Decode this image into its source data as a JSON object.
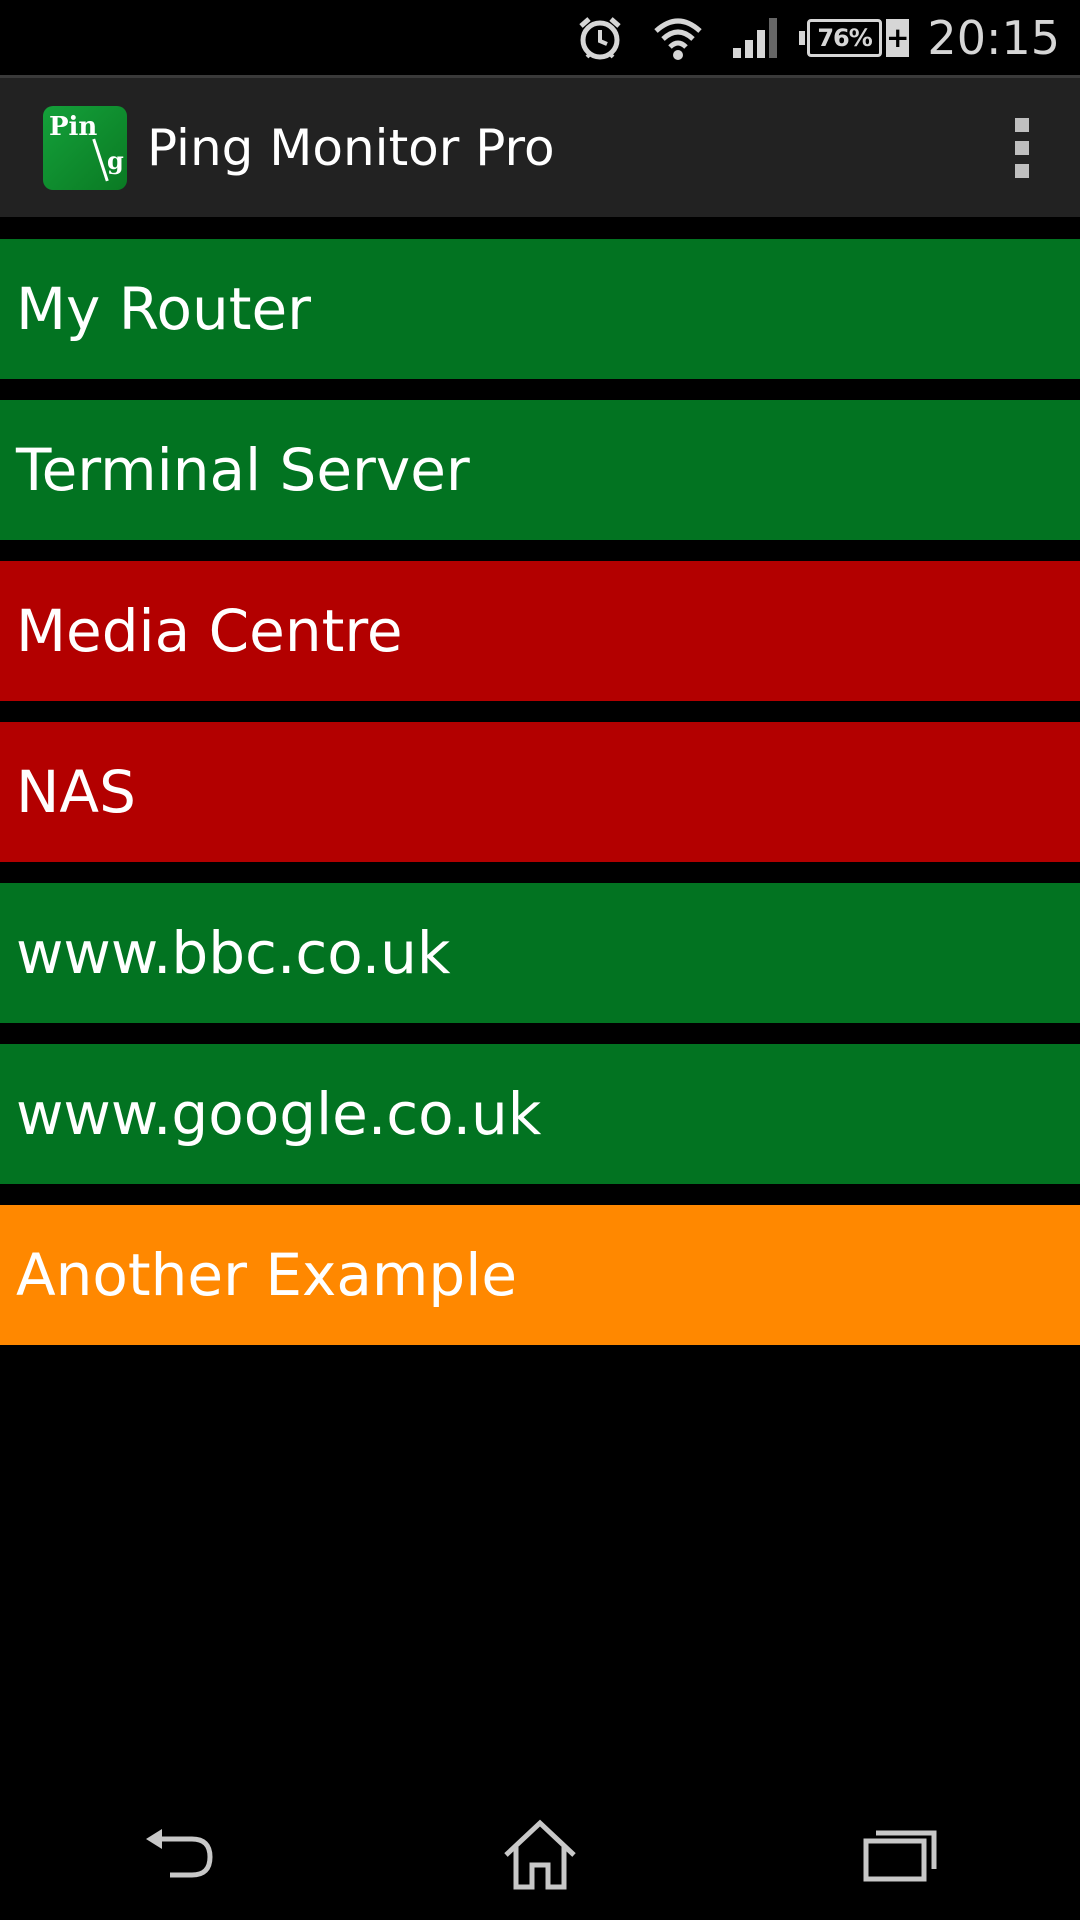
{
  "status_bar": {
    "battery_percent": "76%",
    "battery_plus": "+",
    "time": "20:15",
    "icons": [
      "alarm-icon",
      "wifi-icon",
      "cell-signal-icon",
      "battery-icon"
    ]
  },
  "action_bar": {
    "app_icon_text_top": "Pin",
    "app_icon_text_bottom": "g",
    "title": "Ping Monitor Pro",
    "overflow_icon": "overflow-menu-icon"
  },
  "colors": {
    "up": "#027321",
    "down": "#b30000",
    "warning": "#ff8800",
    "action_bar": "#222222"
  },
  "hosts": [
    {
      "label": "My Router",
      "status": "up"
    },
    {
      "label": "Terminal Server",
      "status": "up"
    },
    {
      "label": "Media Centre",
      "status": "down"
    },
    {
      "label": "NAS",
      "status": "down"
    },
    {
      "label": "www.bbc.co.uk",
      "status": "up"
    },
    {
      "label": "www.google.co.uk",
      "status": "up"
    },
    {
      "label": "Another Example",
      "status": "warning"
    }
  ],
  "nav_bar": {
    "icons": [
      "back-icon",
      "home-icon",
      "recents-icon"
    ]
  }
}
